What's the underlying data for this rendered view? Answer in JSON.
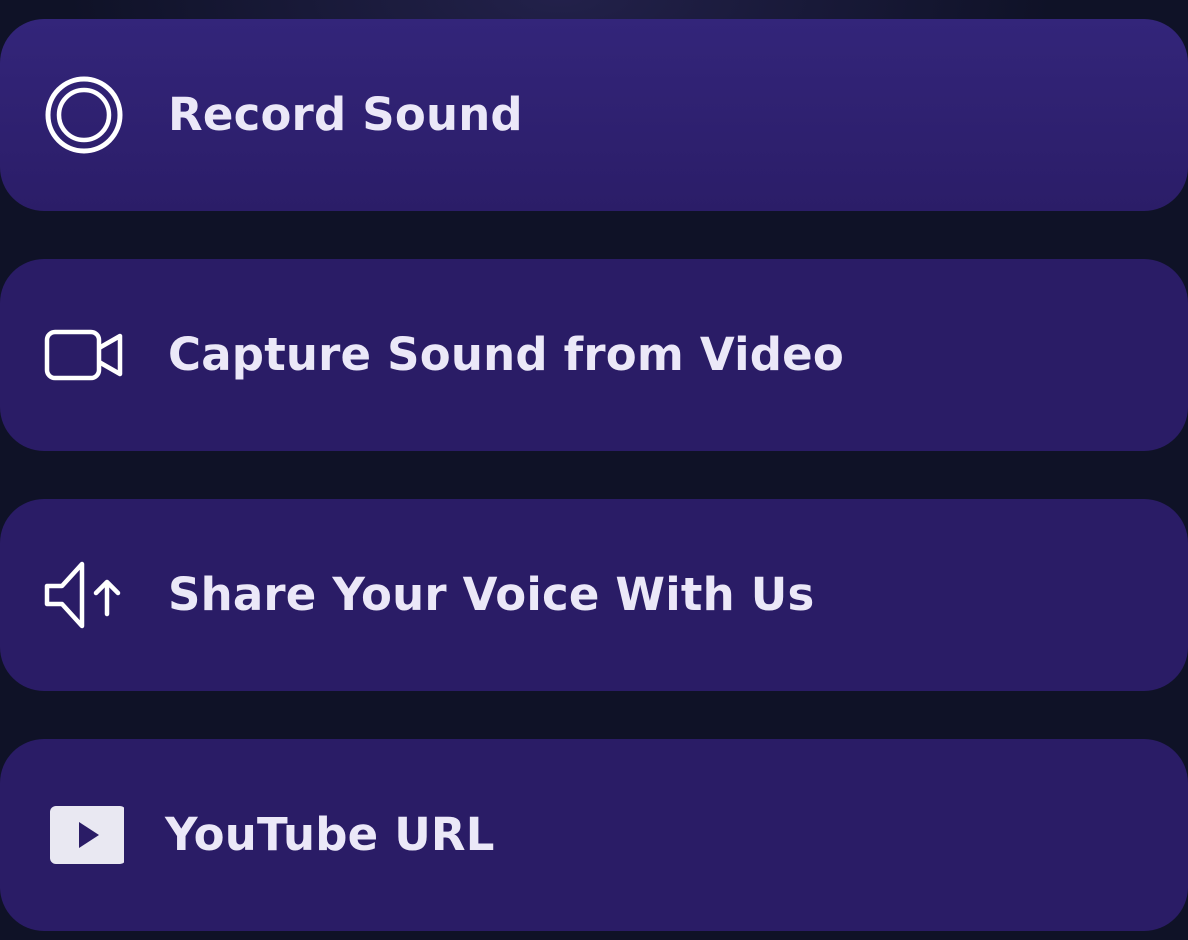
{
  "options": [
    {
      "label": "Record Sound",
      "icon": "record-icon"
    },
    {
      "label": "Capture Sound from Video",
      "icon": "video-camera-icon"
    },
    {
      "label": "Share Your Voice With Us",
      "icon": "speaker-upload-icon"
    },
    {
      "label": "YouTube URL",
      "icon": "youtube-icon"
    }
  ],
  "colors": {
    "background": "#0f1227",
    "card": "#2a1c66",
    "text": "#ebe8f8",
    "icon": "#ffffff"
  }
}
